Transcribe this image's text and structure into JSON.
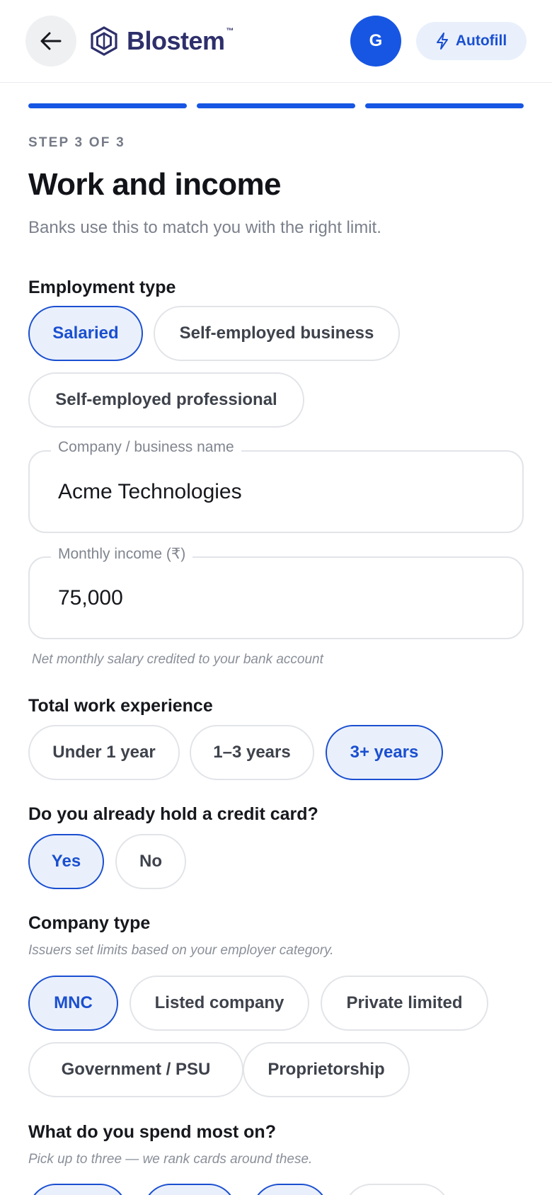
{
  "header": {
    "back_icon": "arrow-left-icon",
    "logo_icon": "blostem-hexagon-logo",
    "logo_text": "Blostem",
    "logo_tm": "™",
    "avatar_initial": "G",
    "autofill_icon": "lightning-bolt-icon",
    "autofill_label": "Autofill"
  },
  "progress": {
    "steps_total": 3,
    "steps_complete": 3,
    "color": "#1756e3"
  },
  "step_label": "STEP 3 OF 3",
  "title": "Work and income",
  "subtitle": "Banks use this to match you with the right limit.",
  "employment": {
    "label": "Employment type",
    "options": [
      "Salaried",
      "Self-employed business",
      "Self-employed professional"
    ],
    "selected": "Salaried"
  },
  "company_field": {
    "label": "Company / business name",
    "value": "Acme Technologies"
  },
  "income_field": {
    "label": "Monthly income (₹)",
    "value": "75,000",
    "hint": "Net monthly salary credited to your bank account"
  },
  "experience": {
    "label": "Total work experience",
    "options": [
      "Under 1 year",
      "1–3 years",
      "3+ years"
    ],
    "selected": "3+ years"
  },
  "credit_card": {
    "label": "Do you already hold a credit card?",
    "options": [
      "Yes",
      "No"
    ],
    "selected": "Yes"
  },
  "company_type": {
    "label": "Company type",
    "hint": "Issuers set limits based on your employer category.",
    "options": [
      "MNC",
      "Listed company",
      "Private limited",
      "Government / PSU",
      "Proprietorship"
    ],
    "selected": "MNC"
  },
  "spend": {
    "label": "What do you spend most on?",
    "hint": "Pick up to three — we rank cards around these."
  },
  "colors": {
    "accent": "#1a4fd0",
    "selected_bg": "#eaf0fb",
    "brand": "#2e2f6b"
  }
}
